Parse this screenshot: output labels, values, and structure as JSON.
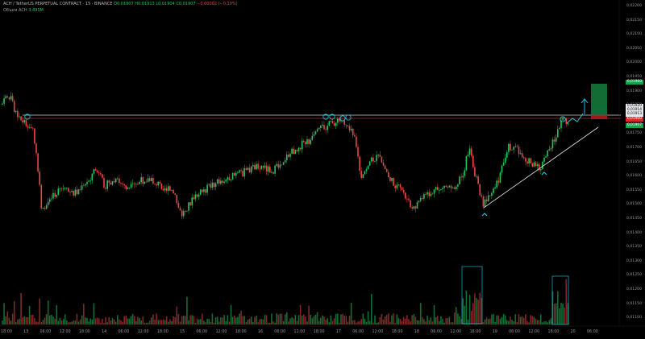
{
  "header": {
    "symbol_line": "ACH / TetherUS PERPETUAL CONTRACT · 15 · BINANCE",
    "open": "O0,01907",
    "high": "H0,01913",
    "low": "L0,01904",
    "close": "C0,01907",
    "change": "−0,00002 (−0,10%)",
    "indicator_label": "Объем",
    "indicator_symbol": "ACH",
    "volume_value": "3,491M"
  },
  "price_axis": {
    "labels": [
      "0,02200",
      "0,02150",
      "0,02100",
      "0,02050",
      "0,02000",
      "0,01950",
      "0,01900",
      "0,01850",
      "0,01800",
      "0,01750",
      "0,01700",
      "0,01650",
      "0,01600",
      "0,01550",
      "0,01500",
      "0,01450",
      "0,01400",
      "0,01350",
      "0,01300",
      "0,01250",
      "0,01200",
      "0,01150",
      "0,01100"
    ]
  },
  "price_tags": [
    {
      "text": "0,01960",
      "bg": "#16a34a",
      "fg": "#ffffff"
    },
    {
      "text": "0,01920",
      "bg": "#e5e7eb",
      "fg": "#000000"
    },
    {
      "text": "0,01914",
      "bg": "#e5e7eb",
      "fg": "#000000"
    },
    {
      "text": "0,01913",
      "bg": "#e5e7eb",
      "fg": "#000000"
    },
    {
      "text": "0,01900",
      "bg": "#dc2626",
      "fg": "#ffffff"
    },
    {
      "text": "0,01907",
      "bg": "#16a34a",
      "fg": "#ffffff"
    }
  ],
  "time_axis": {
    "labels": [
      "18:00",
      "13",
      "06:00",
      "12:00",
      "18:00",
      "14",
      "06:00",
      "12:00",
      "18:00",
      "15",
      "06:00",
      "12:00",
      "18:00",
      "16",
      "06:00",
      "12:00",
      "18:00",
      "17",
      "06:00",
      "12:00",
      "18:00",
      "18",
      "06:00",
      "12:00",
      "18:00",
      "19",
      "06:00",
      "12:00",
      "18:00",
      "20",
      "06:00"
    ]
  },
  "colors": {
    "up": "#22c55e",
    "down": "#ef4444",
    "accent": "#22d3ee",
    "resistance": "#d4d4d4",
    "target_zone": "#15803d"
  }
}
